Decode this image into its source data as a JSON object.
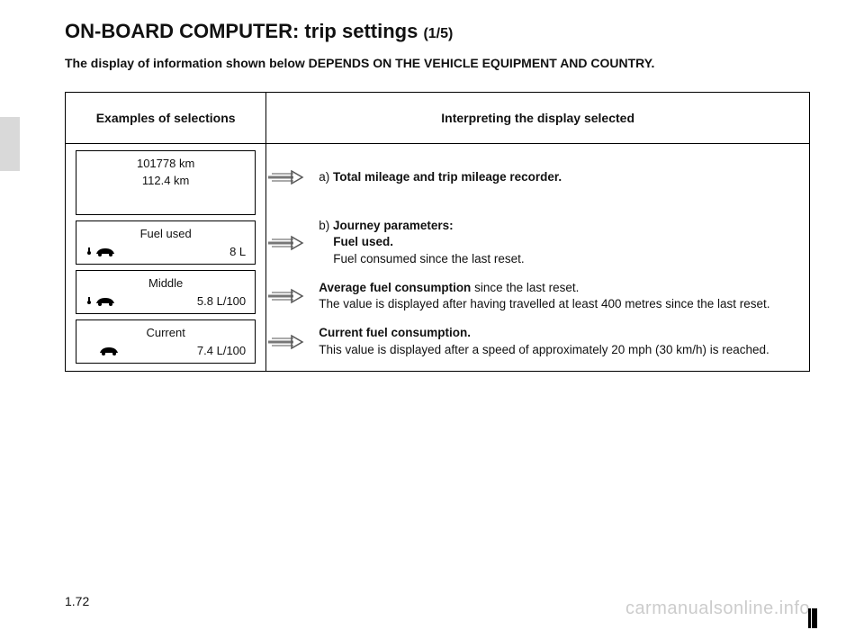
{
  "title_main": "ON-BOARD COMPUTER: trip settings ",
  "title_sub": "(1/5)",
  "notice": "The display of information shown below DEPENDS ON THE VEHICLE EQUIPMENT AND COUNTRY.",
  "table": {
    "header_examples": "Examples of selections",
    "header_interpret": "Interpreting the display selected"
  },
  "rows": [
    {
      "display": {
        "line1": "101778 km",
        "line2": "112.4 km"
      },
      "desc_prefix": "a) ",
      "desc_bold": "Total mileage and trip mileage recorder.",
      "desc_rest": ""
    },
    {
      "display": {
        "line1": "Fuel used",
        "value": "8 L",
        "iconset": "pump-car"
      },
      "desc_prefix": "b) ",
      "desc_bold": "Journey parameters:",
      "desc_bold2": "Fuel used.",
      "desc_rest": "Fuel consumed since the last reset."
    },
    {
      "display": {
        "line1": "Middle",
        "value": "5.8 L/100",
        "iconset": "pump-car"
      },
      "desc_bold": "Average fuel consumption",
      "desc_mid": " since the last reset.",
      "desc_rest": "The value is displayed after having travelled at least 400 metres since the last reset."
    },
    {
      "display": {
        "line1": "Current",
        "value": "7.4 L/100",
        "iconset": "car"
      },
      "desc_bold": "Current fuel consumption.",
      "desc_rest": "This value is displayed after a speed of approximately 20 mph (30 km/h) is reached."
    }
  ],
  "page_number": "1.72",
  "watermark": "carmanualsonline.info"
}
